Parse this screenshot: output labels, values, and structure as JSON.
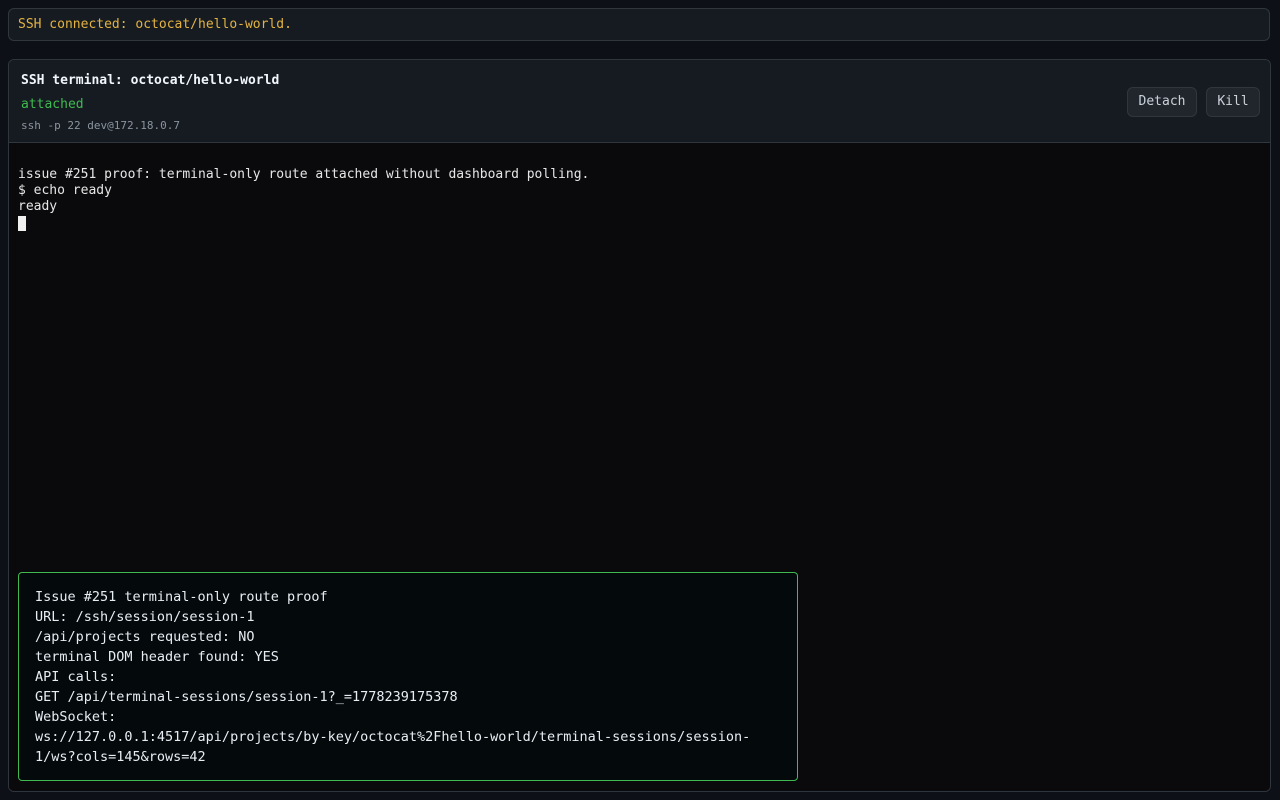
{
  "banner": {
    "message": "SSH connected: octocat/hello-world."
  },
  "terminal_panel": {
    "title": "SSH terminal: octocat/hello-world",
    "status": "attached",
    "command": "ssh -p 22 dev@172.18.0.7",
    "detach_label": "Detach",
    "kill_label": "Kill"
  },
  "terminal_output": {
    "lines": [
      "issue #251 proof: terminal-only route attached without dashboard polling.",
      "$ echo ready",
      "ready"
    ]
  },
  "proof_overlay": {
    "lines": [
      "Issue #251 terminal-only route proof",
      "URL: /ssh/session/session-1",
      "/api/projects requested: NO",
      "terminal DOM header found: YES",
      "API calls:",
      "GET /api/terminal-sessions/session-1?_=1778239175378",
      "WebSocket:",
      "ws://127.0.0.1:4517/api/projects/by-key/octocat%2Fhello-world/terminal-sessions/session-",
      "1/ws?cols=145&rows=42"
    ]
  },
  "colors": {
    "background": "#0d1117",
    "banner_text": "#e3b341",
    "status_ok": "#3fb950",
    "proof_border": "#3fb950"
  }
}
